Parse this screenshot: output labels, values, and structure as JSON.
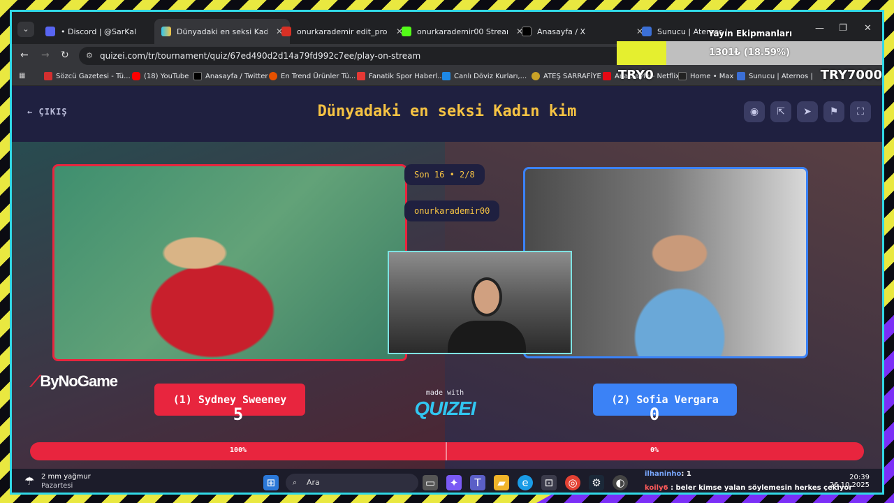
{
  "colors": {
    "accent_yellow": "#f6c343",
    "left_red": "#e8253e",
    "right_blue": "#3b82f6",
    "frame_cyan": "#31d9e6",
    "donation_fill": "#e5ef2f"
  },
  "browser": {
    "tabs": [
      {
        "title": "• Discord | @SarKal",
        "icon": "discord-icon"
      },
      {
        "title": "Dünyadaki en seksi Kadın",
        "icon": "quizei-icon"
      },
      {
        "title": "onurkarademir edit_prob",
        "icon": "gmail-icon"
      },
      {
        "title": "onurkarademir00 Stream",
        "icon": "kick-icon"
      },
      {
        "title": "Anasayfa / X",
        "icon": "x-icon"
      },
      {
        "title": "Sunucu | Aternos |",
        "icon": "aternos-icon"
      }
    ],
    "url": "quizei.com/tr/tournament/quiz/67ed490d2d14a79fd992c7ee/play-on-stream",
    "bookmarks": [
      {
        "label": "Sözcü Gazetesi - Tü...",
        "color": "#d32f2f"
      },
      {
        "label": "(18) YouTube",
        "color": "#ff0000"
      },
      {
        "label": "Anasayfa / Twitter",
        "color": "#000000"
      },
      {
        "label": "En Trend Ürünler Tü...",
        "color": "#e65100"
      },
      {
        "label": "Fanatik Spor Haberl...",
        "color": "#e53935"
      },
      {
        "label": "Canlı Döviz Kurları,...",
        "color": "#1e88e5"
      },
      {
        "label": "ATEŞ SARRAFİYE",
        "color": "#c9a227"
      },
      {
        "label": "Ana Sayfa - Netflix",
        "color": "#e50914"
      },
      {
        "label": "Home • Max",
        "color": "#222222"
      },
      {
        "label": "Sunucu | Aternos |",
        "color": "#3b6fd6"
      }
    ]
  },
  "quiz": {
    "exit_label": "ÇIKIŞ",
    "title": "Dünyadaki en seksi Kadın kim",
    "round": "Son 16 • 2/8",
    "username": "onurkarademir00",
    "left": {
      "name": "(1) Sydney Sweeney",
      "score": "5",
      "percent_label": "100%",
      "percent": 100
    },
    "right": {
      "name": "(2) Sofia Vergara",
      "score": "0",
      "percent_label": "0%",
      "percent": 0
    },
    "made_with": "made with",
    "brand": "QUIZEI",
    "sponsor_logo": "ByNoGame"
  },
  "donation": {
    "title": "Yayın Ekipmanları",
    "amount_text": "1301₺ (18.59%)",
    "progress": 18.59,
    "min_label": "TRY0",
    "max_label": "TRY7000"
  },
  "taskbar": {
    "weather_line1": "2 mm yağmur",
    "weather_line2": "Pazartesi",
    "weather_badge": "2",
    "search_placeholder": "Ara",
    "chat": [
      {
        "user": "ilhaninho",
        "message": ": 1"
      },
      {
        "user": "koily6",
        "message": ": beler kimse yalan söylemesin herkes çekiyor"
      }
    ],
    "time": "20:39",
    "date": "26.10.2025"
  }
}
